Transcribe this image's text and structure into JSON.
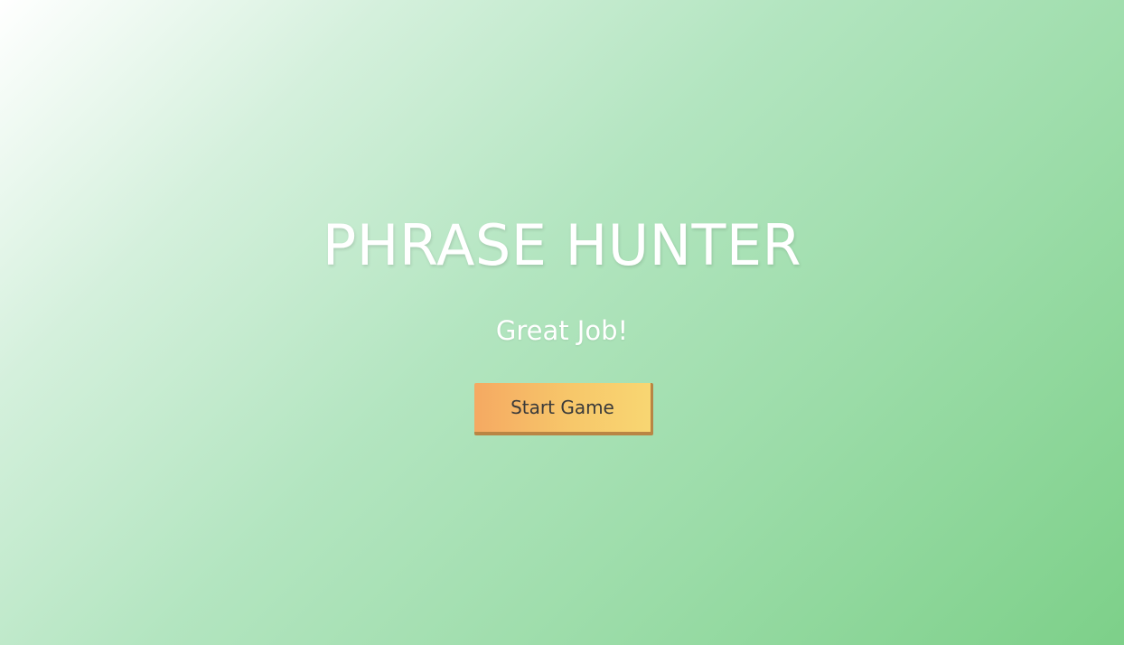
{
  "game": {
    "title": "PHRASE HUNTER",
    "message": "Great Job!",
    "start_button_label": "Start Game"
  },
  "colors": {
    "title_text": "#ffffff",
    "background_start": "#ffffff",
    "background_end": "#7dd089",
    "button_start": "#f5a962",
    "button_end": "#f8d672",
    "button_text": "#3a3a3a"
  }
}
